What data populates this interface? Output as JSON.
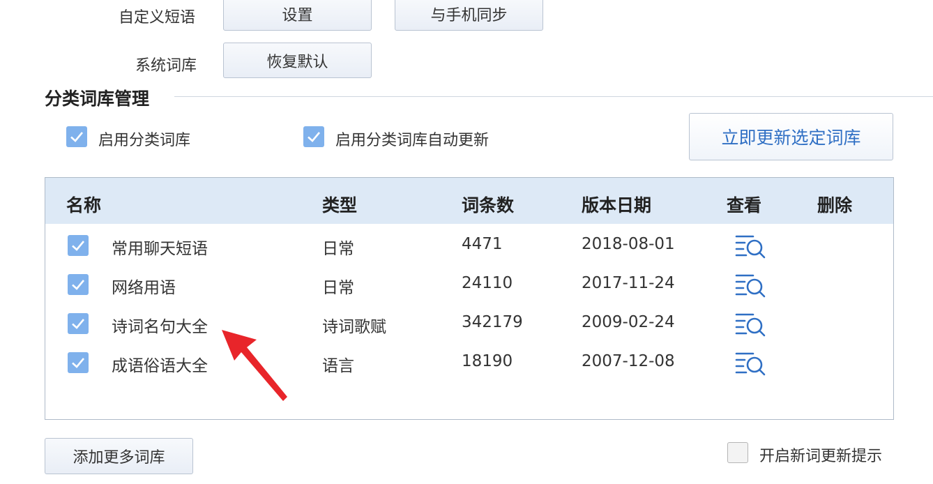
{
  "settings": {
    "custom_phrase_label": "自定义短语",
    "settings_button": "设置",
    "sync_button": "与手机同步",
    "system_lexicon_label": "系统词库",
    "restore_default_button": "恢复默认"
  },
  "category_section": {
    "title": "分类词库管理",
    "enable_category_label": "启用分类词库",
    "enable_category_checked": true,
    "auto_update_label": "启用分类词库自动更新",
    "auto_update_checked": true,
    "update_now_button": "立即更新选定词库"
  },
  "table": {
    "columns": [
      "名称",
      "类型",
      "词条数",
      "版本日期",
      "查看",
      "删除"
    ],
    "rows": [
      {
        "checked": true,
        "name": "常用聊天短语",
        "type": "日常",
        "count": "4471",
        "date": "2018-08-01",
        "view_icon": "list-search-icon"
      },
      {
        "checked": true,
        "name": "网络用语",
        "type": "日常",
        "count": "24110",
        "date": "2017-11-24",
        "view_icon": "list-search-icon"
      },
      {
        "checked": true,
        "name": "诗词名句大全",
        "type": "诗词歌赋",
        "count": "342179",
        "date": "2009-02-24",
        "view_icon": "list-search-icon"
      },
      {
        "checked": true,
        "name": "成语俗语大全",
        "type": "语言",
        "count": "18190",
        "date": "2007-12-08",
        "view_icon": "list-search-icon"
      }
    ]
  },
  "footer": {
    "add_more_button": "添加更多词库",
    "new_word_tip_label": "开启新词更新提示",
    "new_word_tip_checked": false
  },
  "colors": {
    "checkbox_checked": "#7fb1ec",
    "header_bg": "#dde9f6",
    "primary_text": "#2f6fc4",
    "arrow": "#e8252a"
  }
}
